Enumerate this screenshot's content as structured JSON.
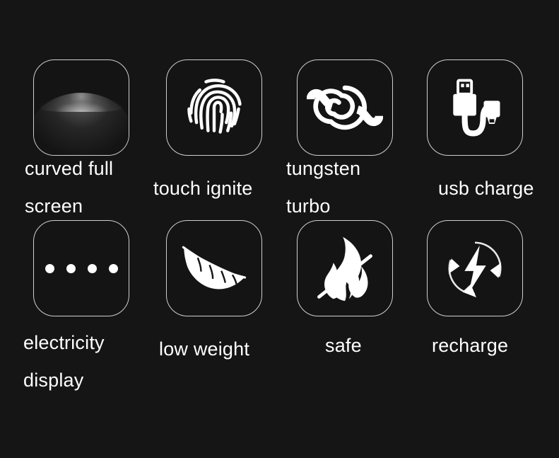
{
  "page": {
    "background_color": "#151515",
    "text_color": "#ffffff",
    "tile_border_color": "#cfcfcf",
    "layout": "2 rows x 4 columns feature grid"
  },
  "features": [
    {
      "id": "curved-full-screen",
      "icon": "curved-screen-icon",
      "label_lines": [
        "curved full",
        "screen"
      ],
      "label": "curved full screen"
    },
    {
      "id": "touch-ignite",
      "icon": "fingerprint-icon",
      "label_lines": [
        "touch ignite"
      ],
      "label": "touch ignite"
    },
    {
      "id": "tungsten-turbo",
      "icon": "spiral-coil-icon",
      "label_lines": [
        "tungsten",
        "turbo"
      ],
      "label": "tungsten turbo"
    },
    {
      "id": "usb-charge",
      "icon": "usb-cable-icon",
      "label_lines": [
        "usb charge"
      ],
      "label": "usb charge"
    },
    {
      "id": "electricity-display",
      "icon": "four-dots-icon",
      "label_lines": [
        "electricity",
        "display"
      ],
      "label": "electricity display"
    },
    {
      "id": "low-weight",
      "icon": "feather-icon",
      "label_lines": [
        "low weight"
      ],
      "label": "low weight"
    },
    {
      "id": "safe",
      "icon": "flame-icon",
      "label_lines": [
        "safe"
      ],
      "label": "safe"
    },
    {
      "id": "recharge",
      "icon": "recharge-lightning-icon",
      "label_lines": [
        "recharge"
      ],
      "label": "recharge"
    }
  ]
}
